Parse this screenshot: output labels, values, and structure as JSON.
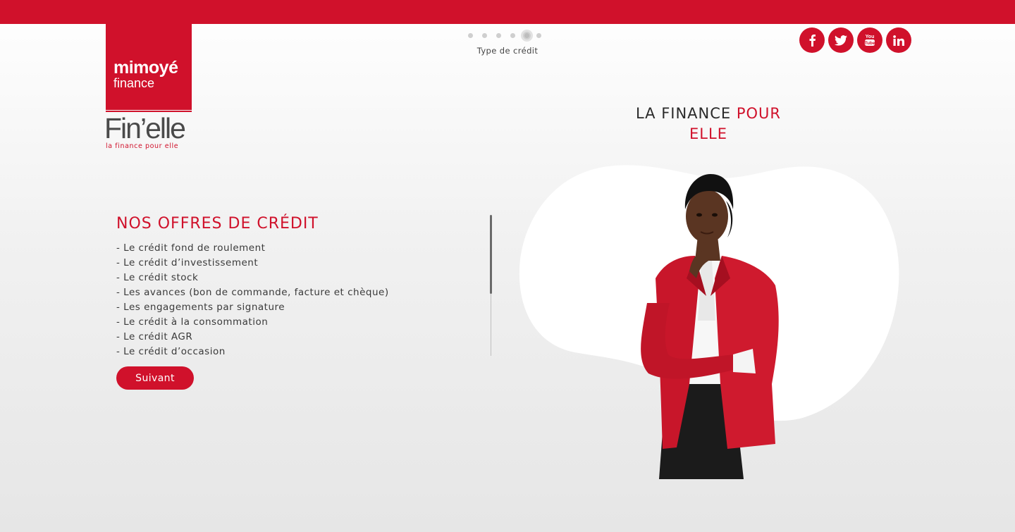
{
  "colors": {
    "brand_red": "#d0112b",
    "text_dark": "#2a2a2a",
    "text_body": "#3a3a3a"
  },
  "logo": {
    "brand": "mimoyé",
    "sub": "finance",
    "product": "Fin’elle",
    "tagline": "la finance pour elle"
  },
  "stepper": {
    "total_steps": 6,
    "active_step": 5,
    "label": "Type de crédit"
  },
  "social": [
    {
      "name": "facebook",
      "icon": "facebook-icon",
      "glyph": "f"
    },
    {
      "name": "twitter",
      "icon": "twitter-icon"
    },
    {
      "name": "youtube",
      "icon": "youtube-icon"
    },
    {
      "name": "linkedin",
      "icon": "linkedin-icon",
      "glyph": "in"
    }
  ],
  "headline": {
    "part1": "LA FINANCE ",
    "part2": "POUR",
    "part3": "ELLE"
  },
  "offers": {
    "title": "NOS OFFRES DE CRÉDIT",
    "items": [
      "- Le crédit fond de roulement",
      "- Le crédit d’investissement",
      "- Le crédit stock",
      "- Les avances (bon de commande, facture et chèque)",
      "- Les engagements par signature",
      "- Le crédit à la consommation",
      "- Le crédit AGR",
      "- Le crédit d’occasion"
    ],
    "next_label": "Suivant"
  },
  "hero": {
    "image": "woman-in-red-blazer"
  }
}
